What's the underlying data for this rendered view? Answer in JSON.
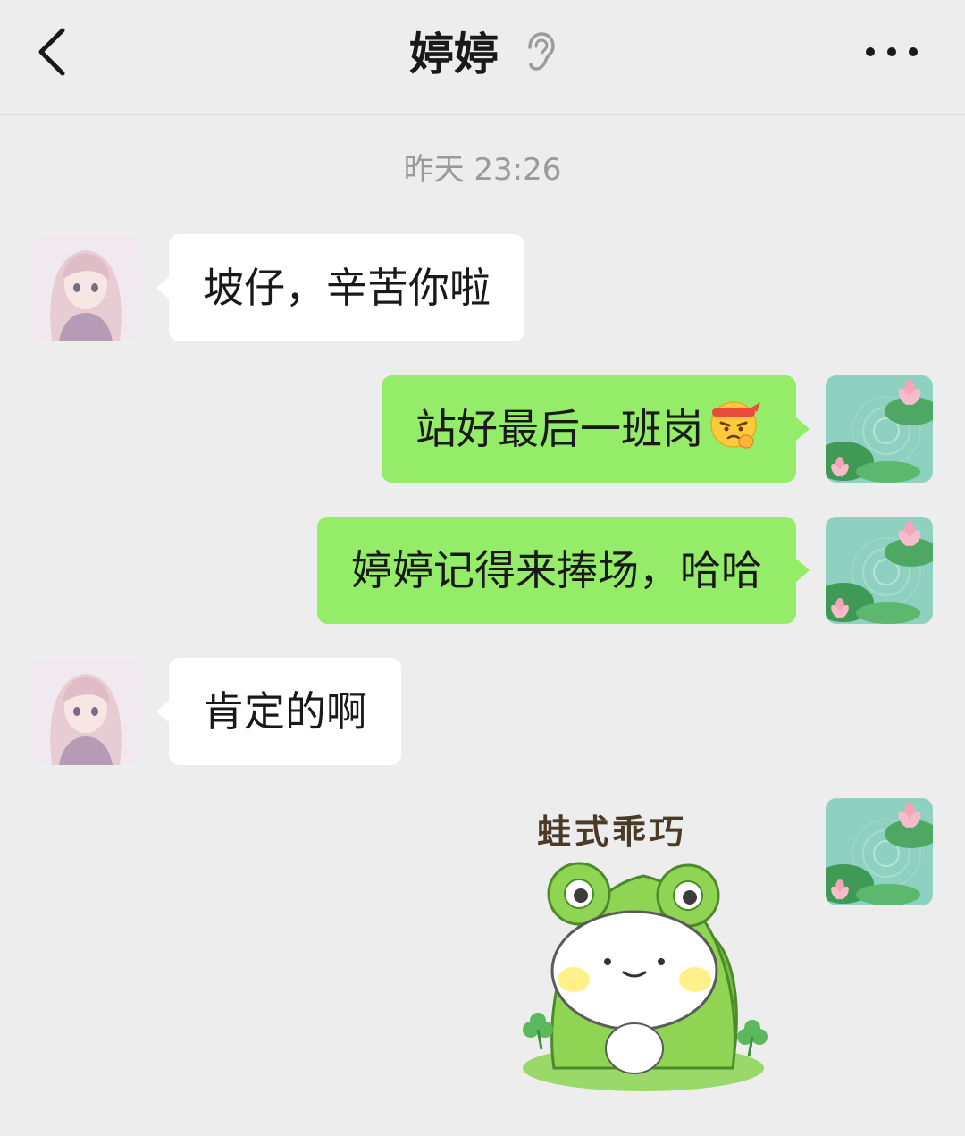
{
  "header": {
    "title": "婷婷",
    "back_icon": "chevron-left-icon",
    "mode_icon": "ear-icon",
    "more_icon": "more-dots-icon"
  },
  "chat": {
    "timestamp": "昨天 23:26",
    "messages": [
      {
        "side": "left",
        "text": "坡仔，辛苦你啦"
      },
      {
        "side": "right",
        "text": "站好最后一班岗",
        "emoji": "determined-headband-emoji"
      },
      {
        "side": "right",
        "text": "婷婷记得来捧场，哈哈"
      },
      {
        "side": "left",
        "text": "肯定的啊"
      },
      {
        "side": "right",
        "sticker": "frog-hat-bunny-sticker",
        "sticker_caption": "蛙式乖巧"
      }
    ]
  },
  "colors": {
    "background": "#ededed",
    "bubble_left": "#ffffff",
    "bubble_right": "#95ec69",
    "timestamp": "#9a9a9a"
  }
}
